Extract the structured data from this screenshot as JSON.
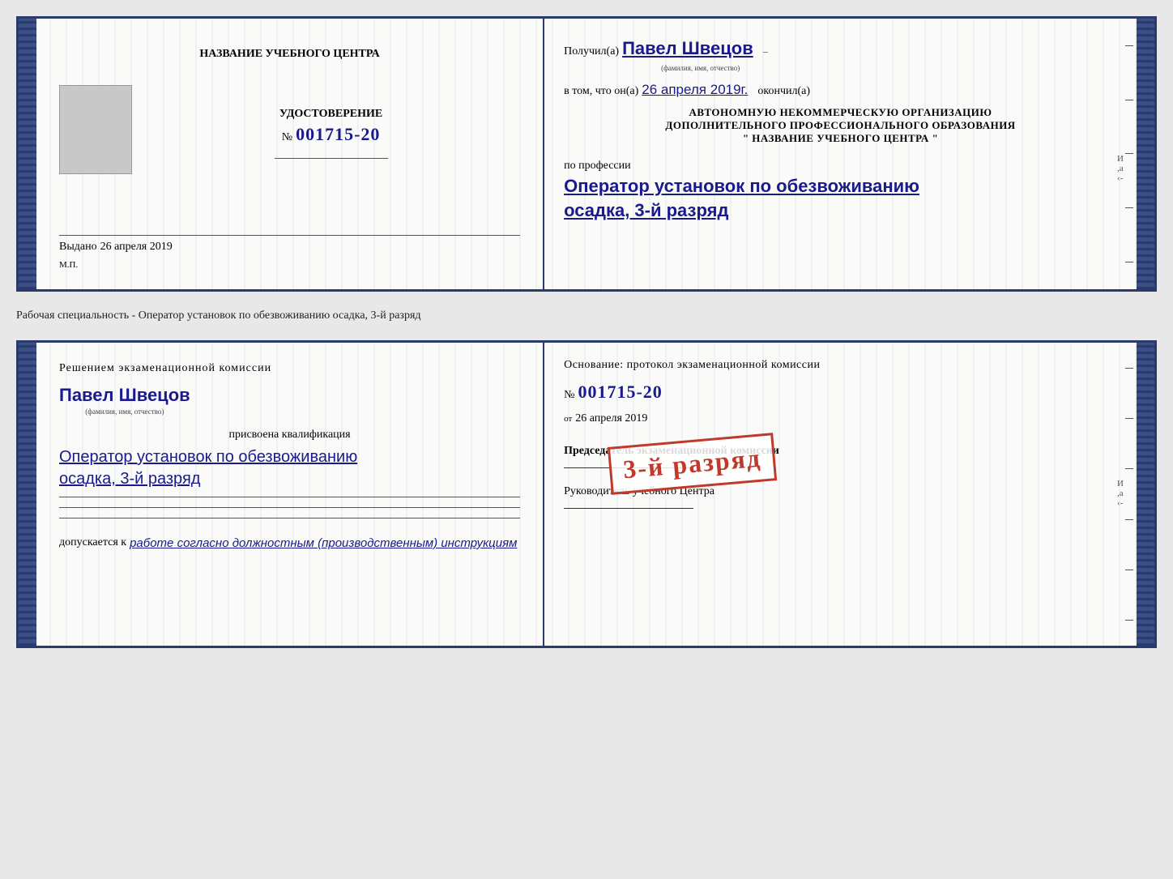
{
  "doc1": {
    "left": {
      "title_line1": "НАЗВАНИЕ УЧЕБНОГО ЦЕНТРА",
      "cert_label": "УДОСТОВЕРЕНИЕ",
      "cert_number_prefix": "№",
      "cert_number": "001715-20",
      "issued_label": "Выдано",
      "issued_date": "26 апреля 2019",
      "mp_label": "М.П."
    },
    "right": {
      "received_prefix": "Получил(а)",
      "received_name": "Павел Швецов",
      "fio_caption": "(фамилия, имя, отчество)",
      "that_prefix": "в том, что он(а)",
      "that_date": "26 апреля 2019г.",
      "finished_label": "окончил(а)",
      "org_line1": "АВТОНОМНУЮ НЕКОММЕРЧЕСКУЮ ОРГАНИЗАЦИЮ",
      "org_line2": "ДОПОЛНИТЕЛЬНОГО ПРОФЕССИОНАЛЬНОГО ОБРАЗОВАНИЯ",
      "org_line3": "\"   НАЗВАНИЕ УЧЕБНОГО ЦЕНТРА   \"",
      "profession_label": "по профессии",
      "profession_value": "Оператор установок по обезвоживанию",
      "specialty_value": "осадка, 3-й разряд"
    }
  },
  "between_label": "Рабочая специальность - Оператор установок по обезвоживанию осадка, 3-й разряд",
  "doc2": {
    "left": {
      "decision_label": "Решением экзаменационной комиссии",
      "person_name": "Павел Швецов",
      "fio_caption": "(фамилия, имя, отчество)",
      "qualification_label": "присвоена квалификация",
      "qualification_value1": "Оператор установок по обезвоживанию",
      "qualification_value2": "осадка, 3-й разряд",
      "allowed_label": "допускается к",
      "allowed_value": "работе согласно должностным (производственным) инструкциям"
    },
    "right": {
      "basis_label": "Основание: протокол экзаменационной комиссии",
      "protocol_prefix": "№",
      "protocol_number": "001715-20",
      "date_prefix": "от",
      "date_value": "26 апреля 2019",
      "chairman_label": "Председатель экзаменационной комиссии",
      "director_label": "Руководитель учебного Центра"
    },
    "stamp": {
      "text": "3-й разряд"
    }
  }
}
